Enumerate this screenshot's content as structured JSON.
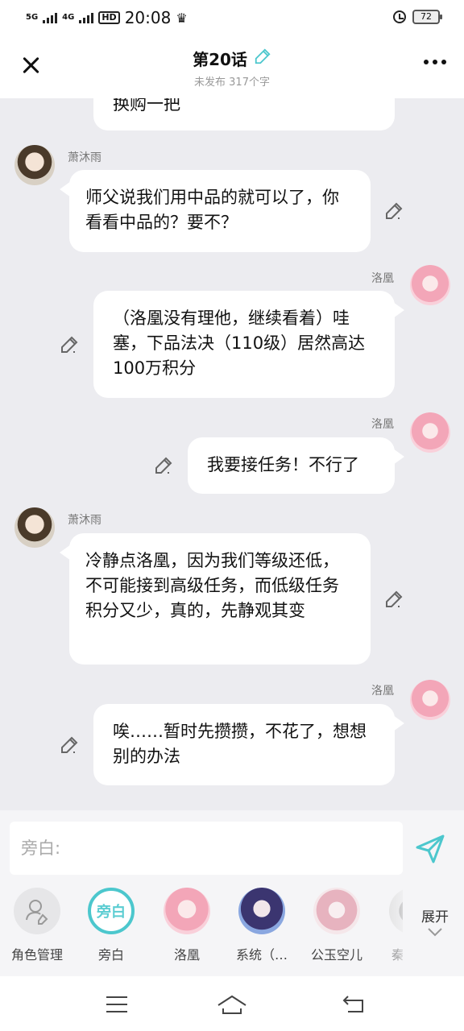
{
  "status_bar": {
    "signal_1": "5G",
    "signal_2": "4G",
    "hd": "HD",
    "time": "20:08",
    "battery": "72"
  },
  "header": {
    "title": "第20话",
    "subtitle": "未发布 317个字"
  },
  "messages": [
    {
      "side": "right",
      "text": "换购一把"
    },
    {
      "side": "left",
      "name": "萧沐雨",
      "text": "师父说我们用中品的就可以了，你看看中品的？要不？"
    },
    {
      "side": "right",
      "name": "洛凰",
      "text": "（洛凰没有理他，继续看着）哇塞，下品法决（110级）居然高达100万积分"
    },
    {
      "side": "right",
      "name": "洛凰",
      "text": "我要接任务！不行了"
    },
    {
      "side": "left",
      "name": "萧沐雨",
      "text": "冷静点洛凰，因为我们等级还低，不可能接到高级任务，而低级任务积分又少，真的，先静观其变"
    },
    {
      "side": "right",
      "name": "洛凰",
      "text": "唉……暂时先攒攒，不花了，想想别的办法"
    }
  ],
  "composer": {
    "placeholder": "旁白:",
    "expand_label": "展开"
  },
  "roles": [
    {
      "label": "角色管理"
    },
    {
      "label": "旁白",
      "badge": "旁白"
    },
    {
      "label": "洛凰"
    },
    {
      "label": "系统（…"
    },
    {
      "label": "公玉空儿"
    },
    {
      "label": "秦"
    }
  ],
  "colors": {
    "accent": "#4cc7cd",
    "chat_background": "#ececf0"
  }
}
